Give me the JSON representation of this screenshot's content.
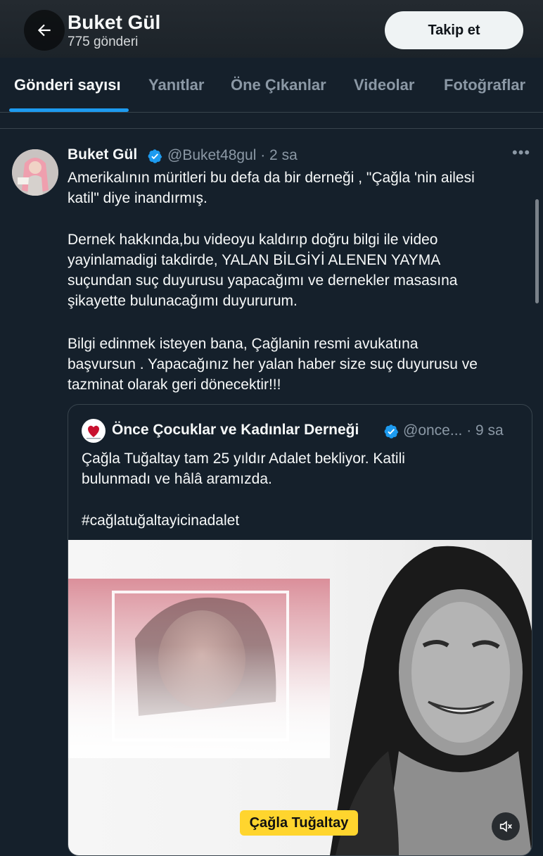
{
  "header": {
    "profile_name": "Buket Gül",
    "post_count": "775 gönderi",
    "follow_label": "Takip et"
  },
  "tabs": [
    {
      "label": "Gönderi sayısı",
      "active": true
    },
    {
      "label": "Yanıtlar",
      "active": false
    },
    {
      "label": "Öne Çıkanlar",
      "active": false
    },
    {
      "label": "Videolar",
      "active": false
    },
    {
      "label": "Fotoğraflar",
      "active": false
    }
  ],
  "tweet": {
    "author": "Buket Gül",
    "handle_time": "@Buket48gul · 2 sa",
    "lines": [
      "Amerikalının müritleri bu defa da bir derneği , \"Çağla 'nin ailesi",
      "katil\" diye inandırmış.",
      "Dernek hakkında,bu videoyu kaldırıp doğru bilgi ile video",
      "yayinlamadigi takdirde, YALAN BİLGİYİ ALENEN YAYMA",
      "suçundan suç duyurusu yapacağımı ve dernekler masasına",
      "şikayette bulunacağımı duyururum.",
      "Bilgi edinmek isteyen bana, Çağlanin resmi avukatına",
      "başvursun . Yapacağınız her yalan haber size suç duyurusu ve",
      "tazminat olarak geri dönecektir!!!"
    ]
  },
  "quote": {
    "author": "Önce Çocuklar ve Kadınlar Derneği",
    "handle_time": "@once... · 9 sa",
    "lines": [
      "Çağla Tuğaltay tam 25 yıldır Adalet bekliyor. Katili",
      "bulunmadı ve hâlâ aramızda.",
      "#cağlatuğaltayicinadalet"
    ],
    "media_caption": "Çağla Tuğaltay"
  },
  "colors": {
    "background": "#15202b",
    "accent": "#1d9bf0",
    "muted_text": "#8b98a5",
    "caption_yellow": "#ffd52e"
  },
  "icons": [
    "back-arrow-icon",
    "verified-badge-icon",
    "more-icon",
    "mute-icon"
  ]
}
